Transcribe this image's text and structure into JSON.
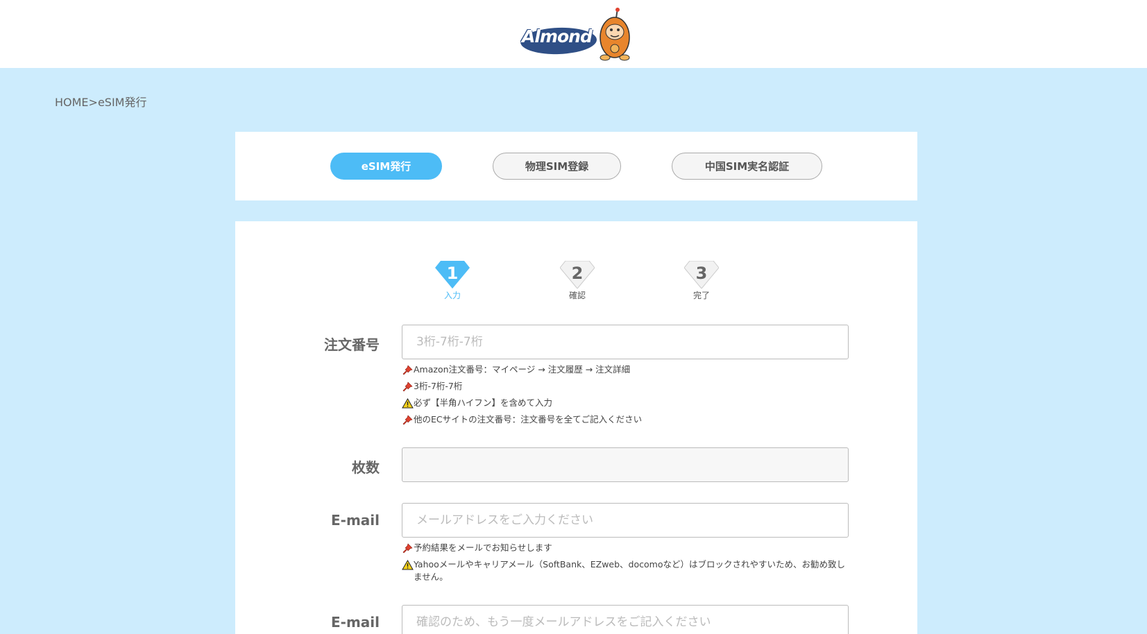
{
  "brand": {
    "name": "Almond"
  },
  "breadcrumb": {
    "text": "HOME>eSIM発行"
  },
  "tabs": [
    {
      "label": "eSIM発行",
      "active": true
    },
    {
      "label": "物理SIM登録",
      "active": false
    },
    {
      "label": "中国SIM実名認証",
      "active": false
    }
  ],
  "steps": [
    {
      "number": "1",
      "label": "入力",
      "active": true
    },
    {
      "number": "2",
      "label": "確認",
      "active": false
    },
    {
      "number": "3",
      "label": "完了",
      "active": false
    }
  ],
  "form": {
    "order": {
      "label": "注文番号",
      "placeholder": "3桁-7桁-7桁",
      "value": "",
      "notes": [
        {
          "icon": "pin-icon",
          "text": "Amazon注文番号：マイページ → 注文履歴 → 注文詳細"
        },
        {
          "icon": "pin-icon",
          "text": "3桁-7桁-7桁"
        },
        {
          "icon": "warning-icon",
          "text": "必ず【半角ハイフン】を含めて入力"
        },
        {
          "icon": "pin-icon",
          "text": "他のECサイトの注文番号：注文番号を全てご記入ください"
        }
      ]
    },
    "quantity": {
      "label": "枚数",
      "value": ""
    },
    "email": {
      "label": "E-mail",
      "placeholder": "メールアドレスをご入力ください",
      "value": "",
      "notes": [
        {
          "icon": "pin-icon",
          "text": "予約結果をメールでお知らせします"
        },
        {
          "icon": "warning-icon",
          "text": "Yahooメールやキャリアメール（SoftBank、EZweb、docomoなど）はブロックされやすいため、お勧め致しません。"
        }
      ]
    },
    "email_confirm": {
      "label": "E-mail",
      "placeholder": "確認のため、もう一度メールアドレスをご記入ください",
      "value": ""
    }
  },
  "colors": {
    "accent": "#4dbcf6",
    "background": "#cdecfd",
    "pin": "#e0412f",
    "warning": "#f5d21a"
  }
}
